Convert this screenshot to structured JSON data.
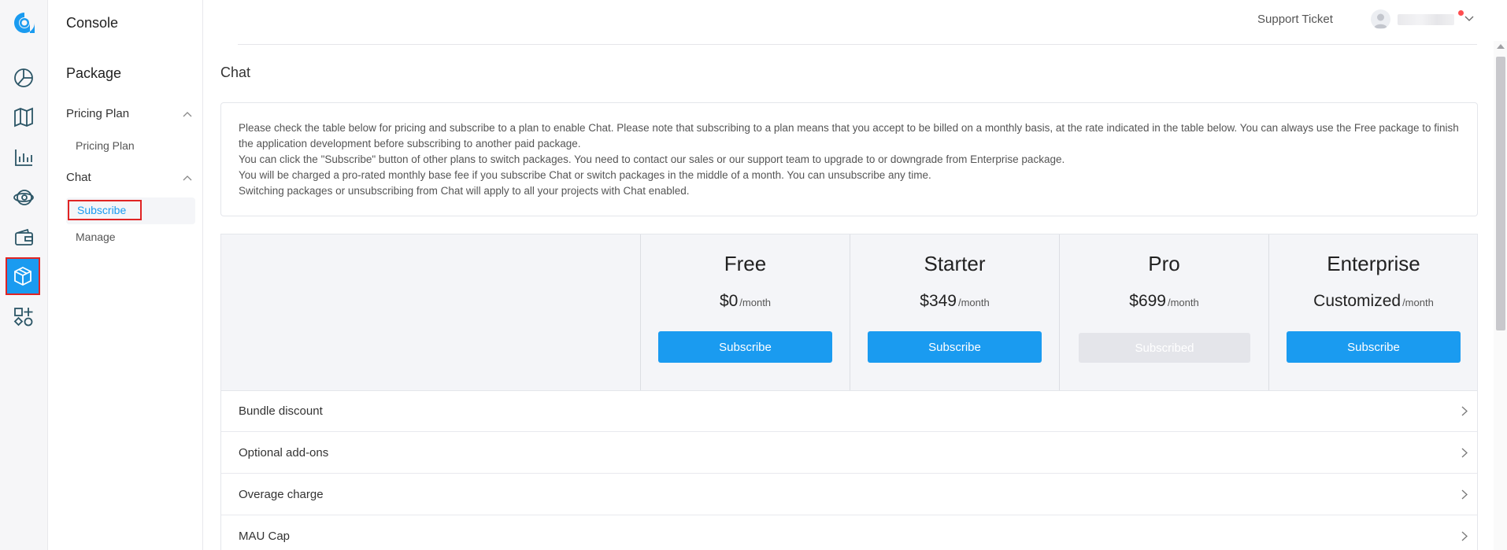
{
  "brand": {
    "logo_icon": "agora-logo-icon",
    "accent": "#1a9bf0"
  },
  "rail": {
    "icons": [
      "dashboard-pie-icon",
      "map-icon",
      "bar-chart-icon",
      "analytics-globe-icon",
      "wallet-icon",
      "package-box-icon",
      "extensions-icon"
    ],
    "active": "package-box-icon"
  },
  "sidebar": {
    "console_title": "Console",
    "section_title": "Package",
    "groups": [
      {
        "label": "Pricing Plan",
        "items": [
          {
            "label": "Pricing Plan"
          }
        ]
      },
      {
        "label": "Chat",
        "items": [
          {
            "label": "Subscribe",
            "active": true
          },
          {
            "label": "Manage"
          }
        ]
      }
    ]
  },
  "header": {
    "support_ticket": "Support Ticket",
    "avatar_icon": "user-avatar-icon"
  },
  "page": {
    "title": "Chat",
    "notice": [
      "Please check the table below for pricing and subscribe to a plan to enable Chat. Please note that subscribing to a plan means that you accept to be billed on a monthly basis, at the rate indicated in the table below. You can always use the Free package to finish the application development before subscribing to another paid package.",
      "You can click the \"Subscribe\" button of other plans to switch packages. You need to contact our sales or our support team to upgrade to or downgrade from Enterprise package.",
      "You will be charged a pro-rated monthly base fee if you subscribe Chat or switch packages in the middle of a month. You can unsubscribe any time.",
      "Switching packages or unsubscribing from Chat will apply to all your projects with Chat enabled."
    ],
    "plans": [
      {
        "name": "Free",
        "price": "$0",
        "per": "/month",
        "button": "Subscribe"
      },
      {
        "name": "Starter",
        "price": "$349",
        "per": "/month",
        "button": "Subscribe"
      },
      {
        "name": "Pro",
        "price": "$699",
        "per": "/month",
        "button": "Subscribed"
      },
      {
        "name": "Enterprise",
        "price": "Customized",
        "per": "/month",
        "button": "Subscribe"
      }
    ],
    "rows": [
      "Bundle discount",
      "Optional add-ons",
      "Overage charge",
      "MAU Cap"
    ]
  }
}
